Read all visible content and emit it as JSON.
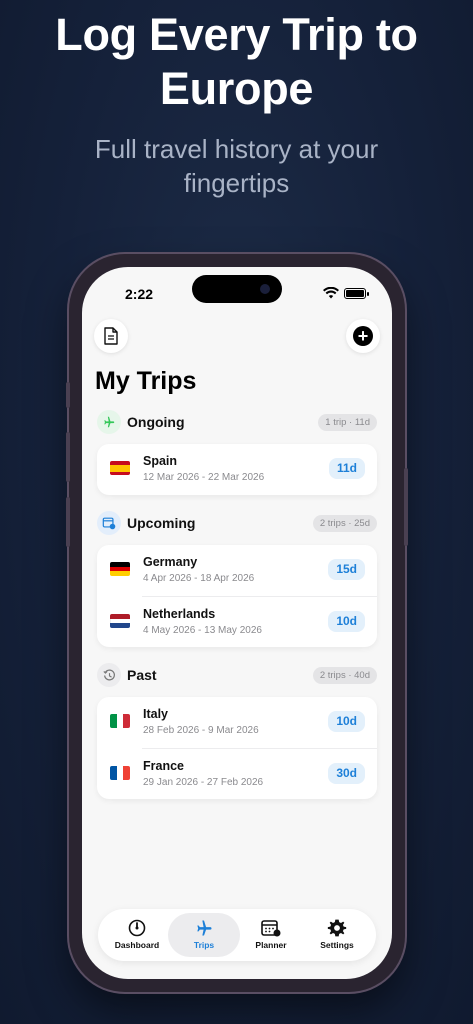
{
  "promo": {
    "headline_line1": "Log Every Trip to",
    "headline_line2": "Europe",
    "subhead_line1": "Full travel history at your",
    "subhead_line2": "fingertips"
  },
  "status_bar": {
    "time": "2:22"
  },
  "header": {
    "title": "My Trips",
    "left_icon": "document-icon",
    "right_icon": "plus-icon"
  },
  "sections": [
    {
      "label": "Ongoing",
      "badge": "1 trip · 11d",
      "icon": "airplane-icon",
      "trips": [
        {
          "country": "Spain",
          "dates": "12 Mar 2026 - 22 Mar 2026",
          "days": "11d",
          "flag": [
            "#c60b1e",
            "#ffc400",
            "#c60b1e"
          ]
        }
      ]
    },
    {
      "label": "Upcoming",
      "badge": "2 trips · 25d",
      "icon": "calendar-clock-icon",
      "trips": [
        {
          "country": "Germany",
          "dates": "4 Apr 2026 - 18 Apr 2026",
          "days": "15d",
          "flag": [
            "#000000",
            "#dd0000",
            "#ffce00"
          ]
        },
        {
          "country": "Netherlands",
          "dates": "4 May 2026 - 13 May 2026",
          "days": "10d",
          "flag": [
            "#ae1c28",
            "#ffffff",
            "#21468b"
          ]
        }
      ]
    },
    {
      "label": "Past",
      "badge": "2 trips · 40d",
      "icon": "history-icon",
      "trips": [
        {
          "country": "Italy",
          "dates": "28 Feb 2026 - 9 Mar 2026",
          "days": "10d",
          "flag": [
            "#009246",
            "#ffffff",
            "#ce2b37"
          ]
        },
        {
          "country": "France",
          "dates": "29 Jan 2026 - 27 Feb 2026",
          "days": "30d",
          "flag": [
            "#0055a4",
            "#ffffff",
            "#ef4135"
          ]
        }
      ]
    }
  ],
  "tabbar": {
    "items": [
      {
        "label": "Dashboard",
        "icon": "gauge-icon"
      },
      {
        "label": "Trips",
        "icon": "airplane-icon",
        "active": true
      },
      {
        "label": "Planner",
        "icon": "calendar-icon"
      },
      {
        "label": "Settings",
        "icon": "gear-icon"
      }
    ]
  },
  "colors": {
    "accent": "#1e80d8",
    "ongoing_icon": "#34c759",
    "badge_bg": "#e3f0fb"
  }
}
